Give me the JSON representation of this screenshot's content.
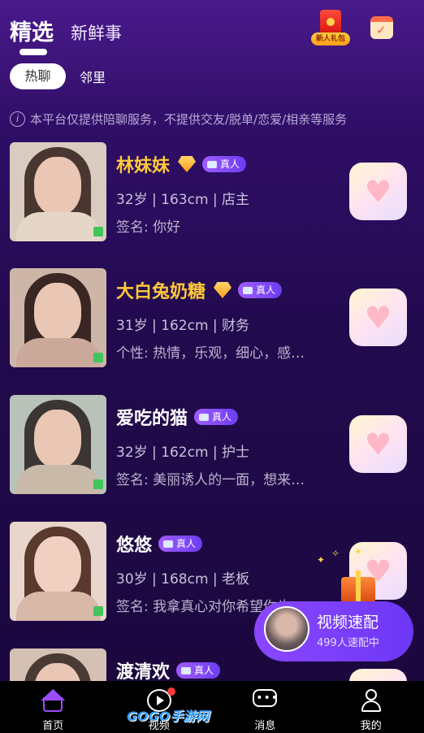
{
  "header": {
    "tab_featured": "精选",
    "tab_news": "新鲜事",
    "gift_label": "新人礼包"
  },
  "subtabs": {
    "active": "热聊",
    "inactive": "邻里"
  },
  "notice": "本平台仅提供陪聊服务，不提供交友/脱单/恋爱/相亲等服务",
  "real_badge": "真人",
  "users": [
    {
      "name": "林妹妹",
      "vip": true,
      "info": "32岁 | 163cm | 店主",
      "bio": "签名: 你好"
    },
    {
      "name": "大白兔奶糖",
      "vip": true,
      "info": "31岁 | 162cm | 财务",
      "bio": "个性: 热情，乐观，细心，感…"
    },
    {
      "name": "爱吃的猫",
      "vip": false,
      "info": "32岁 | 162cm | 护士",
      "bio": "签名: 美丽诱人的一面，想来…"
    },
    {
      "name": "悠悠",
      "vip": false,
      "info": "30岁 | 168cm | 老板",
      "bio": "签名: 我拿真心对你希望你也"
    },
    {
      "name": "渡清欢",
      "vip": false,
      "info": "",
      "bio": ""
    }
  ],
  "match": {
    "title": "视频速配",
    "subtitle": "499人速配中"
  },
  "nav": {
    "home": "首页",
    "video": "视频",
    "messages": "消息",
    "me": "我的"
  },
  "watermark": "GOGO手游网",
  "colors": {
    "accent": "#9b4dff",
    "vip_name": "#ffc93a",
    "online": "#41c55a"
  }
}
